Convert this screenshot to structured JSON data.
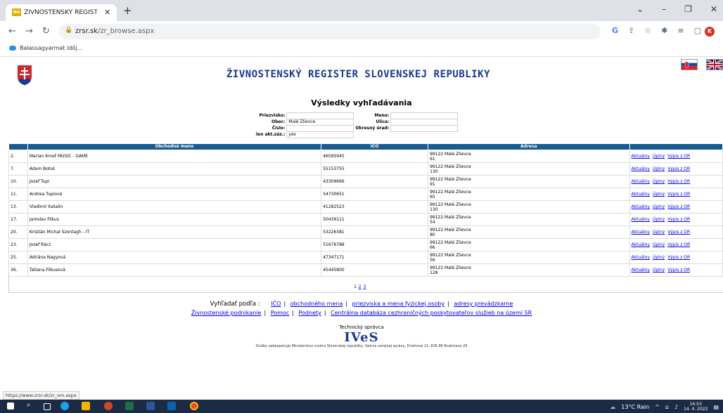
{
  "browser": {
    "tab_title": "ŽIVNOSTENSKÝ REGISTER SLOVE",
    "tab_favicon": "Nó",
    "url_host": "zrsr.sk",
    "url_path": "/zr_browse.aspx",
    "profile_initial": "K",
    "bookmark": "Balassagyarmat időj..."
  },
  "header": {
    "site_title": "ŽIVNOSTENSKÝ REGISTER SLOVENSKEJ REPUBLIKY"
  },
  "results_title": "Výsledky vyhľadávania",
  "criteria": {
    "priezvisko_label": "Priezvisko:",
    "obec_label": "Obec:",
    "obec_value": "Malé Zlievce",
    "cislo_label": "Číslo:",
    "akt_label": "len akt.záz.:",
    "akt_value": "yes",
    "meno_label": "Meno:",
    "ulica_label": "Ulica:",
    "urad_label": "Okresný úrad:"
  },
  "table": {
    "headers": [
      "",
      "Obchodné meno",
      "IČO",
      "Adresa",
      ""
    ],
    "rows": [
      {
        "n": "2.",
        "name": "Marian Kmeť MUSIC - GAME",
        "ico": "46595945",
        "addr1": "99122 Malé Zlievce",
        "addr2": "61"
      },
      {
        "n": "7.",
        "name": "Adam Botoš",
        "ico": "55153755",
        "addr1": "99122 Malé Zlievce",
        "addr2": "130"
      },
      {
        "n": "10.",
        "name": "Jozef Tupi",
        "ico": "43309666",
        "addr1": "99122 Malé Zlievce",
        "addr2": "91"
      },
      {
        "n": "11.",
        "name": "Andrea Tupiová",
        "ico": "54730651",
        "addr1": "99122 Malé Zlievce",
        "addr2": "65"
      },
      {
        "n": "13.",
        "name": "Vladimír Katalin",
        "ico": "41282523",
        "addr1": "99122 Malé Zlievce",
        "addr2": "130"
      },
      {
        "n": "17.",
        "name": "Jaroslav Filkus",
        "ico": "50439111",
        "addr1": "99122 Malé Zlievce",
        "addr2": "54"
      },
      {
        "n": "20.",
        "name": "Kristián Michal Szontagh - IT",
        "ico": "53226381",
        "addr1": "99122 Malé Zlievce",
        "addr2": "80"
      },
      {
        "n": "23.",
        "name": "Jozef Rácz",
        "ico": "51676788",
        "addr1": "99122 Malé Zlievce",
        "addr2": "66"
      },
      {
        "n": "25.",
        "name": "Adriána Nagyová",
        "ico": "47347171",
        "addr1": "99122 Malé Zlievce",
        "addr2": "56"
      },
      {
        "n": "36.",
        "name": "Tatiana Filkusová",
        "ico": "45445800",
        "addr1": "99122 Malé Zlievce",
        "addr2": "128"
      }
    ],
    "link_aktualny": "Aktuálny",
    "link_uplny": "Úplný",
    "link_vypis": "Výpis z OR"
  },
  "pager": [
    "1",
    "2",
    "3"
  ],
  "footer": {
    "lead": "Vyhľadať podľa :",
    "ico": "IČO",
    "obchodne_meno": "obchodného mena",
    "priezviska": "priezviska a mena fyzickej osoby",
    "adresy": "adresy prevádzkarne",
    "zivnostenske": "Živnostenské podnikanie",
    "pomoc": "Pomoc",
    "podnety": "Podnety",
    "centralna": "Centrálna databáza cezhraničných poskytovateľov služieb na území SR",
    "tech_label": "Technický správca",
    "logo": "IVeS",
    "service_note": "Službu zabezpečuje Ministerstvo vnútra Slovenskej republiky, Sekcia verejnej správy, Drieňová 22, 826 86 Bratislava 29"
  },
  "status_url": "https://www.zrsr.sk/zr_om.aspx",
  "taskbar": {
    "weather": "13°C Rain",
    "time": "16:53",
    "date": "14. 4. 2022"
  },
  "colors": {
    "header_blue": "#1a3a8c",
    "table_header": "#1a5a91"
  }
}
